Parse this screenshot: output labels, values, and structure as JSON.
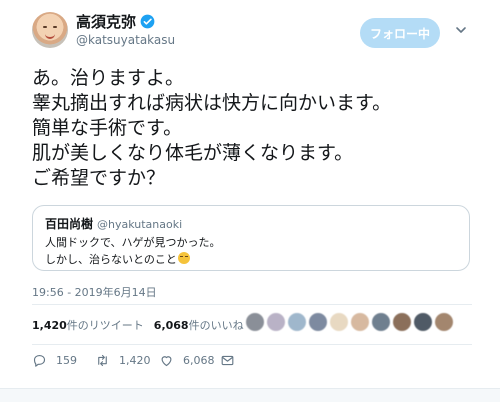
{
  "author": {
    "display_name": "高須克弥",
    "handle": "@katsuyatakasu",
    "verified": true,
    "avatar_icon": "avatar-photo"
  },
  "follow_button": {
    "label": "フォロー中",
    "color": "#b4dcf6"
  },
  "tweet": {
    "lines": [
      "あ。治りますよ。",
      "睾丸摘出すれば病状は快方に向かいます。",
      "簡単な手術です。",
      "肌が美しくなり体毛が薄くなります。",
      "ご希望ですか？"
    ]
  },
  "quoted_tweet": {
    "display_name": "百田尚樹",
    "handle": "@hyakutanaoki",
    "line1": "人間ドックで、ハゲが見つかった。",
    "line2": "しかし、治らないとのこと"
  },
  "timestamp": "19:56 - 2019年6月14日",
  "stats": {
    "retweets_num": "1,420",
    "retweets_label": "件のリツイート",
    "likes_num": "6,068",
    "likes_label": "件のいいね"
  },
  "likers_colors": [
    "#8a8f98",
    "#b9b2c6",
    "#9fb7cc",
    "#7d8aa0",
    "#e8d9c2",
    "#d7b9a0",
    "#6f7f8f",
    "#8b6f5a",
    "#4f5a66",
    "#a3866e"
  ],
  "actions": {
    "reply_count": "159",
    "retweet_count": "1,420",
    "like_count": "6,068"
  },
  "colors": {
    "accent": "#1da1f2",
    "secondary_text": "#657786",
    "border": "#ccd6dd"
  }
}
